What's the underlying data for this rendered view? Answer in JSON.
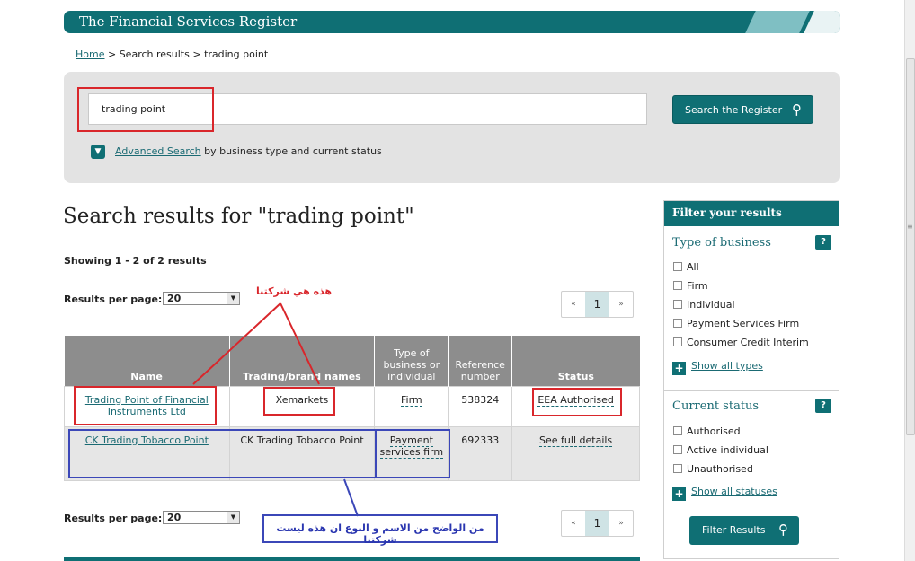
{
  "header": {
    "title": "The Financial Services Register"
  },
  "breadcrumb": {
    "home": "Home",
    "sep1": ">",
    "middle": "Search results",
    "sep2": ">",
    "current": "trading point"
  },
  "search": {
    "value": "trading point",
    "button_label": "Search the Register",
    "advanced_link": "Advanced Search",
    "advanced_suffix": "by business type and current status"
  },
  "results": {
    "title": "Search results for \"trading point\"",
    "showing": "Showing 1 - 2 of 2 results",
    "per_page_label": "Results per page:",
    "per_page_value": "20",
    "pager": {
      "prev": "«",
      "current": "1",
      "next": "»"
    },
    "columns": [
      "Name",
      "Trading/brand names",
      "Type of business or individual",
      "Reference number",
      "Status"
    ],
    "rows": [
      {
        "name": "Trading Point of Financial Instruments Ltd",
        "trading": "Xemarkets",
        "type": "Firm",
        "ref": "538324",
        "status": "EEA Authorised"
      },
      {
        "name": "CK Trading Tobacco Point",
        "trading": "CK Trading Tobacco Point",
        "type": "Payment services firm",
        "ref": "692333",
        "status": "See full details"
      }
    ]
  },
  "filter": {
    "title": "Filter your results",
    "type_title": "Type of business",
    "help": "?",
    "type_options": [
      "All",
      "Firm",
      "Individual",
      "Payment Services Firm",
      "Consumer Credit Interim"
    ],
    "show_all_types": "Show all types",
    "status_title": "Current status",
    "status_options": [
      "Authorised",
      "Active individual",
      "Unauthorised"
    ],
    "show_all_statuses": "Show all statuses",
    "button_label": "Filter Results"
  },
  "annotations": {
    "red_note": "هذه هي شركتنا",
    "blue_note": "من الواضح من الاسم و النوع ان هذه ليست شركتنا"
  },
  "colors": {
    "teal": "#0f6f74",
    "red_annotation": "#d9262b",
    "blue_annotation": "#3b47b8"
  }
}
